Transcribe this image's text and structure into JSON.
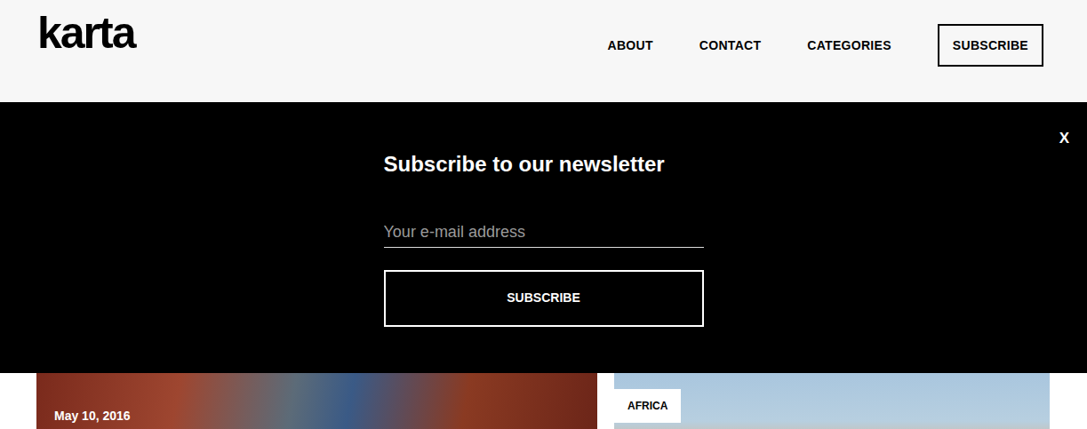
{
  "logo": "karta",
  "nav": {
    "items": [
      {
        "label": "ABOUT"
      },
      {
        "label": "CONTACT"
      },
      {
        "label": "CATEGORIES"
      }
    ],
    "subscribe": "SUBSCRIBE"
  },
  "newsletter": {
    "close": "X",
    "title": "Subscribe to our newsletter",
    "email": {
      "placeholder": "Your e-mail address"
    },
    "button": "SUBSCRIBE"
  },
  "posts": [
    {
      "kind": "dated",
      "label": "May 10, 2016"
    },
    {
      "kind": "category",
      "label": "AFRICA"
    }
  ]
}
